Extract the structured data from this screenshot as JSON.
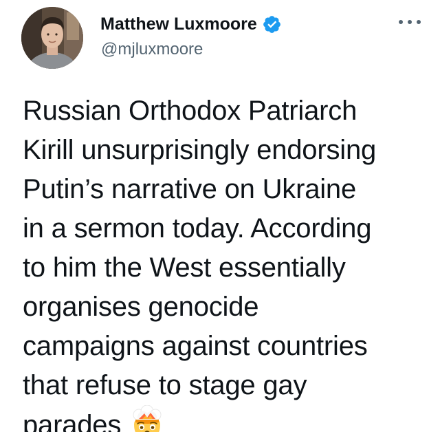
{
  "tweet": {
    "author": {
      "display_name": "Matthew Luxmoore",
      "handle": "@mjluxmoore",
      "verified": true,
      "verified_icon": "verified-badge-icon",
      "avatar_icon": "profile-photo"
    },
    "more_icon": "more-options-icon",
    "text_lines": [
      "Russian Orthodox Patriarch",
      "Kirill unsurprisingly endorsing",
      "Putin’s narrative on Ukraine",
      "in a sermon today. According",
      "to him the West essentially",
      "organises genocide",
      "campaigns against countries",
      "that refuse to stage gay",
      "parades"
    ],
    "trailing_emoji": "exploding-head-emoji"
  },
  "colors": {
    "text": "#0f1419",
    "secondary_text": "#536471",
    "verified_blue": "#1d9bf0",
    "background": "#ffffff"
  }
}
